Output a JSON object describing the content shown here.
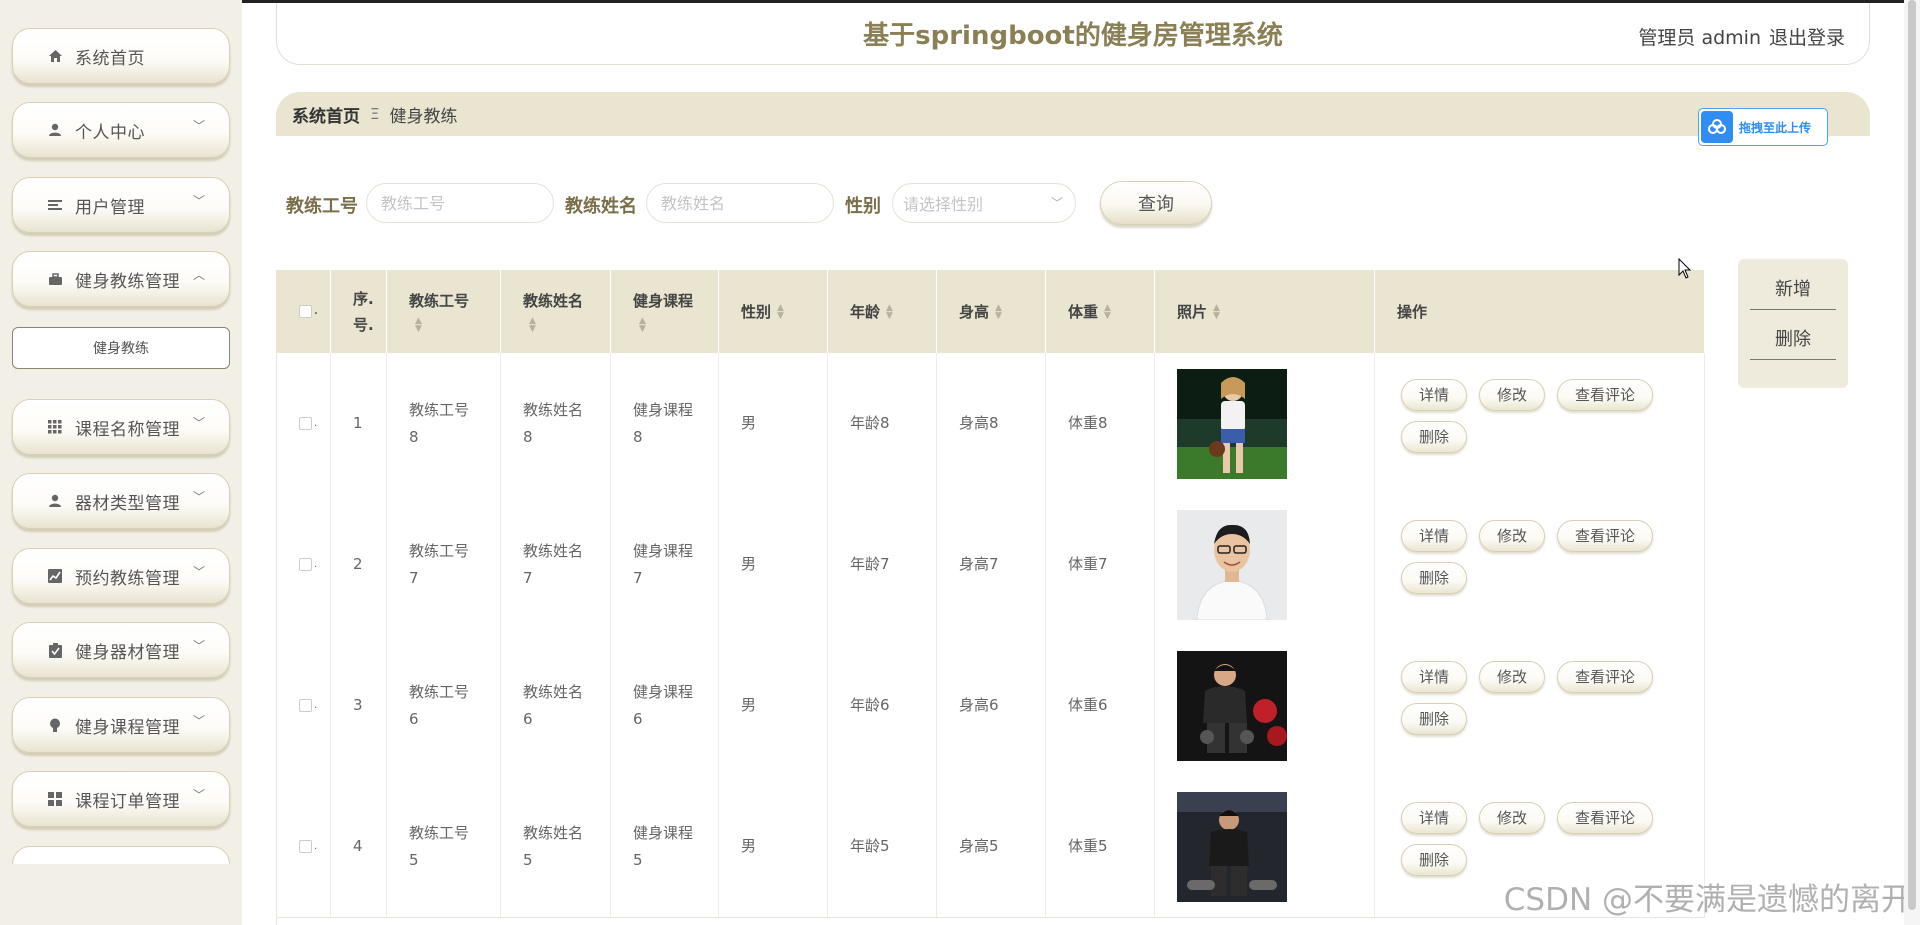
{
  "app": {
    "title": "基于springboot的健身房管理系统",
    "user": "管理员 admin",
    "logout": "退出登录"
  },
  "colors": {
    "accent": "#e9e5d1",
    "title": "#8a7f55",
    "label": "#7a6f4a",
    "sidebar_bg": "#f2f0e6"
  },
  "sidebar": {
    "items": [
      {
        "label": "系统首页",
        "icon": "home-icon"
      },
      {
        "label": "个人中心",
        "icon": "user-icon"
      },
      {
        "label": "用户管理",
        "icon": "list-icon"
      },
      {
        "label": "健身教练管理",
        "icon": "briefcase-icon"
      },
      {
        "label": "课程名称管理",
        "icon": "grid-icon"
      },
      {
        "label": "器材类型管理",
        "icon": "user-icon"
      },
      {
        "label": "预约教练管理",
        "icon": "chart-icon"
      },
      {
        "label": "健身器材管理",
        "icon": "clipboard-icon"
      },
      {
        "label": "健身课程管理",
        "icon": "bulb-icon"
      },
      {
        "label": "课程订单管理",
        "icon": "apps-icon"
      }
    ],
    "submenu": {
      "label": "健身教练"
    }
  },
  "breadcrumb": {
    "home": "系统首页",
    "separator": "Ξ",
    "current": "健身教练"
  },
  "upload": {
    "label": "拖拽至此上传"
  },
  "search": {
    "coach_id_label": "教练工号",
    "coach_id_placeholder": "教练工号",
    "coach_name_label": "教练姓名",
    "coach_name_placeholder": "教练姓名",
    "gender_label": "性别",
    "gender_placeholder": "请选择性别",
    "query_button": "查询"
  },
  "actions": {
    "add": "新增",
    "delete": "删除"
  },
  "table": {
    "headers": {
      "index": "序.号.",
      "coach_id": "教练工号",
      "coach_name": "教练姓名",
      "course": "健身课程",
      "gender": "性别",
      "age": "年龄",
      "height": "身高",
      "weight": "体重",
      "photo": "照片",
      "ops": "操作"
    },
    "buttons": {
      "detail": "详情",
      "edit": "修改",
      "comments": "查看评论",
      "delete": "删除"
    },
    "rows": [
      {
        "index": "1",
        "coach_id": "教练工号8",
        "coach_name": "教练姓名8",
        "course": "健身课程8",
        "gender": "男",
        "age": "年龄8",
        "height": "身高8",
        "weight": "体重8"
      },
      {
        "index": "2",
        "coach_id": "教练工号7",
        "coach_name": "教练姓名7",
        "course": "健身课程7",
        "gender": "男",
        "age": "年龄7",
        "height": "身高7",
        "weight": "体重7"
      },
      {
        "index": "3",
        "coach_id": "教练工号6",
        "coach_name": "教练姓名6",
        "course": "健身课程6",
        "gender": "男",
        "age": "年龄6",
        "height": "身高6",
        "weight": "体重6"
      },
      {
        "index": "4",
        "coach_id": "教练工号5",
        "coach_name": "教练姓名5",
        "course": "健身课程5",
        "gender": "男",
        "age": "年龄5",
        "height": "身高5",
        "weight": "体重5"
      }
    ]
  },
  "watermark": "CSDN @不要满是遗憾的离开"
}
